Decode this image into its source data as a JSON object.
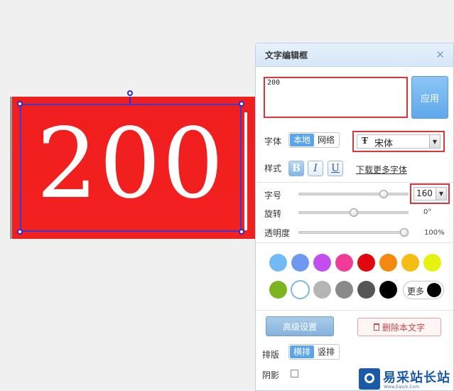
{
  "canvas": {
    "text": "200",
    "background_color": "#f32020",
    "text_color": "#ffffff"
  },
  "panel": {
    "title": "文字编辑框",
    "close_icon": "✕",
    "text_value": "200",
    "apply_label": "应用",
    "font": {
      "label": "字体",
      "source_options": [
        "本地",
        "网络"
      ],
      "selected_source": "本地",
      "font_name": "宋体",
      "font_icon": "Ŧ"
    },
    "style": {
      "label": "样式",
      "bold": "B",
      "italic": "I",
      "underline": "U",
      "more_fonts_link": "下载更多字体"
    },
    "size": {
      "label": "字号",
      "value": "160",
      "slider_fraction": 0.8
    },
    "rotation": {
      "label": "旋转",
      "value": "0°",
      "slider_fraction": 0.5
    },
    "opacity": {
      "label": "透明度",
      "value": "100%",
      "slider_fraction": 1.0
    },
    "colors": {
      "row1": [
        "#72baf5",
        "#6d9af0",
        "#c34ef0",
        "#f03c98",
        "#e0070f",
        "#f5880e",
        "#f5bd12",
        "#e6f20f"
      ],
      "row2": [
        "#7db520",
        "#ffffff",
        "#b5b5b5",
        "#8a8a8a",
        "#555555",
        "#000000"
      ],
      "selected": "#ffffff",
      "more_label": "更多",
      "more_color": "#000000"
    },
    "advanced_label": "高级设置",
    "delete_label": "删除本文字",
    "layout": {
      "label": "排版",
      "options": [
        "横排",
        "竖排"
      ],
      "selected": "横排"
    },
    "shadow": {
      "label": "阴影",
      "checked": false
    }
  },
  "watermark": {
    "text": "易采站长站",
    "sub": "Www.Easck.Com"
  }
}
